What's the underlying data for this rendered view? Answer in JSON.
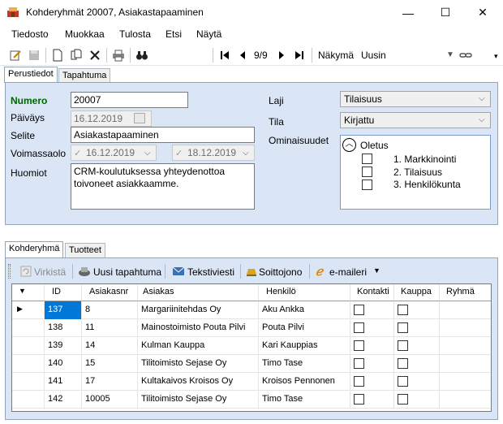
{
  "window": {
    "title": "Kohderyhmät 20007, Asiakastapaaminen",
    "min": "—",
    "max": "☐",
    "close": "✕"
  },
  "menu": [
    "Tiedosto",
    "Muokkaa",
    "Tulosta",
    "Etsi",
    "Näytä"
  ],
  "toolbar": {
    "nav_count": "9/9",
    "view_label": "Näkymä",
    "view_value": "Uusin"
  },
  "tabs_top": [
    "Perustiedot",
    "Tapahtuma"
  ],
  "form": {
    "numero_label": "Numero",
    "numero": "20007",
    "paivays_label": "Päiväys",
    "paivays": "16.12.2019",
    "selite_label": "Selite",
    "selite": "Asiakastapaaminen",
    "voimassaolo_label": "Voimassaolo",
    "voimassa_from": "16.12.2019",
    "voimassa_to": "18.12.2019",
    "huomiot_label": "Huomiot",
    "huomiot": "CRM-koulutuksessa yhteydenottoa toivoneet asiakkaamme.",
    "laji_label": "Laji",
    "laji": "Tilaisuus",
    "tila_label": "Tila",
    "tila": "Kirjattu",
    "ominaisuudet_label": "Ominaisuudet",
    "oletus": "Oletus",
    "props": [
      "1. Markkinointi",
      "2. Tilaisuus",
      "3. Henkilökunta"
    ]
  },
  "tabs_bottom": [
    "Kohderyhmä",
    "Tuotteet"
  ],
  "toolbar2": {
    "virkista": "Virkistä",
    "uusi": "Uusi tapahtuma",
    "teksti": "Tekstiviesti",
    "soitto": "Soittojono",
    "email": "e-maileri"
  },
  "table": {
    "headers": [
      "ID",
      "Asiakasnr",
      "Asiakas",
      "Henkilö",
      "Kontakti",
      "Kauppa",
      "Ryhmä"
    ],
    "rows": [
      {
        "id": "137",
        "nr": "8",
        "asiakas": "Margariinitehdas Oy",
        "henkilo": "Aku Ankka"
      },
      {
        "id": "138",
        "nr": "11",
        "asiakas": "Mainostoimisto Pouta Pilvi",
        "henkilo": "Pouta Pilvi"
      },
      {
        "id": "139",
        "nr": "14",
        "asiakas": "Kulman Kauppa",
        "henkilo": "Kari Kauppias"
      },
      {
        "id": "140",
        "nr": "15",
        "asiakas": "Tilitoimisto Sejase Oy",
        "henkilo": "Timo Tase"
      },
      {
        "id": "141",
        "nr": "17",
        "asiakas": "Kultakaivos Kroisos Oy",
        "henkilo": "Kroisos Pennonen"
      },
      {
        "id": "142",
        "nr": "10005",
        "asiakas": "Tilitoimisto Sejase Oy",
        "henkilo": "Timo Tase"
      }
    ]
  },
  "colors": {
    "panel": "#dae5f5",
    "selected_cell": "#0078d7",
    "numero_label": "#006400"
  }
}
